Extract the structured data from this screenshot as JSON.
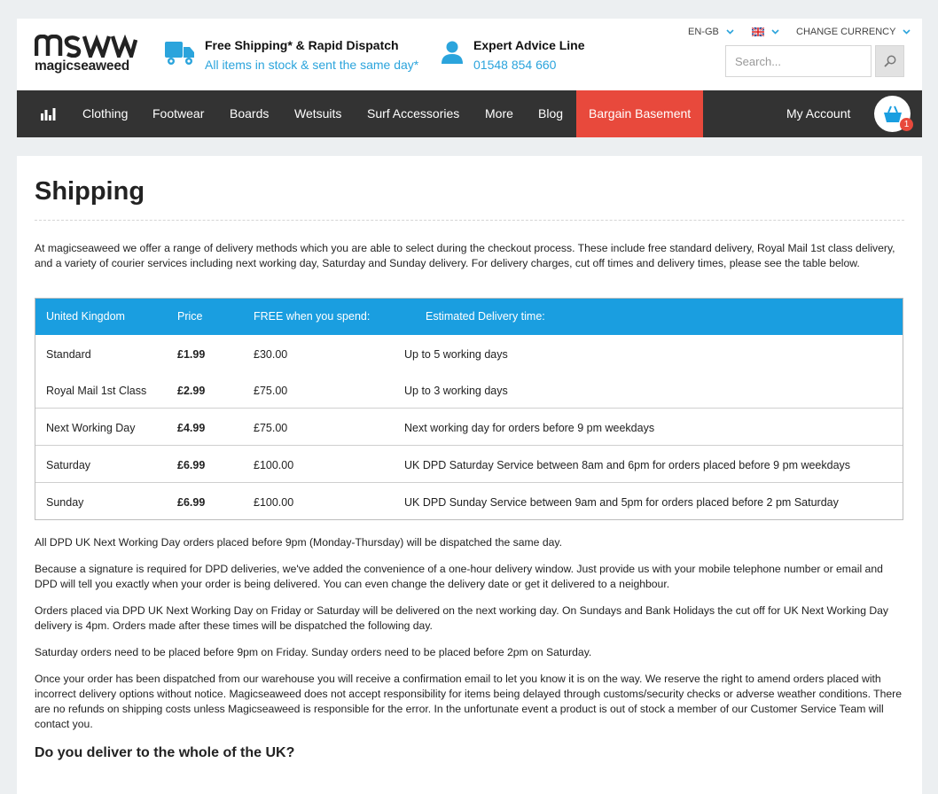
{
  "header": {
    "logo_text": "magicseaweed",
    "usp_shipping": {
      "title": "Free Shipping* & Rapid Dispatch",
      "subtitle": "All items in stock & sent the same day*"
    },
    "usp_advice": {
      "title": "Expert Advice Line",
      "phone": "01548 854 660"
    },
    "language": "EN-GB",
    "currency_label": "CHANGE CURRENCY",
    "search_placeholder": "Search..."
  },
  "nav": {
    "items": [
      "Clothing",
      "Footwear",
      "Boards",
      "Wetsuits",
      "Surf Accessories",
      "More",
      "Blog"
    ],
    "bargain": "Bargain Basement",
    "account": "My Account",
    "cart_count": "1"
  },
  "page": {
    "title": "Shipping",
    "intro": "At magicseaweed we offer a range of delivery methods which you are able to select during the checkout process. These include free standard delivery, Royal Mail 1st class delivery, and a variety of courier services including next working day, Saturday and Sunday delivery. For delivery charges, cut off times and delivery times, please see the table below.",
    "table": {
      "headers": [
        "United Kingdom",
        "Price",
        "FREE when you spend:",
        "Estimated Delivery time:"
      ],
      "rows": [
        {
          "method": "Standard",
          "price": "£1.99",
          "free": "£30.00",
          "time": "Up to 5 working days"
        },
        {
          "method": "Royal Mail 1st Class",
          "price": "£2.99",
          "free": "£75.00",
          "time": "Up to 3 working days"
        },
        {
          "method": "Next Working Day",
          "price": "£4.99",
          "free": "£75.00",
          "time": "Next working day for orders before 9 pm weekdays"
        },
        {
          "method": "Saturday",
          "price": "£6.99",
          "free": "£100.00",
          "time": "UK DPD Saturday Service between 8am and 6pm for orders placed before 9 pm weekdays"
        },
        {
          "method": "Sunday",
          "price": "£6.99",
          "free": "£100.00",
          "time": "UK DPD Sunday Service between 9am and 5pm for orders placed before 2 pm Saturday"
        }
      ]
    },
    "paragraphs": [
      "All DPD UK Next Working Day orders placed before 9pm (Monday-Thursday) will be dispatched the same day.",
      "Because a signature is required for DPD deliveries, we've added the convenience of a one-hour delivery window. Just provide us with your mobile telephone number or email and DPD will tell you exactly when your order is being delivered. You can even change the delivery date or get it delivered to a neighbour.",
      "Orders placed via DPD UK Next Working Day on Friday or Saturday will be delivered on the next working day. On Sundays and Bank Holidays the cut off for UK Next Working Day delivery is 4pm. Orders made after these times will be dispatched the following day.",
      "Saturday orders need to be placed before 9pm on Friday. Sunday orders need to be placed before 2pm on Saturday.",
      "Once your order has been dispatched from our warehouse you will receive a confirmation email to let you know it is on the way. We reserve the right to amend orders placed with incorrect delivery options without notice. Magicseaweed does not accept responsibility for items being delayed through customs/security checks or adverse weather conditions. There are no refunds on shipping costs unless Magicseaweed is responsible for the error. In the unfortunate event a product is out of stock a member of our Customer Service Team will contact you."
    ],
    "sub_heading": "Do you deliver to the whole of the UK?"
  },
  "colors": {
    "accent": "#1a9ee0",
    "link": "#2ba4dc",
    "nav_bg": "#333333",
    "bargain": "#e8493c"
  },
  "icons": [
    "logo-icon",
    "truck-icon",
    "person-icon",
    "chevron-down-icon",
    "uk-flag-icon",
    "search-icon",
    "bars-chart-icon",
    "basket-icon"
  ]
}
